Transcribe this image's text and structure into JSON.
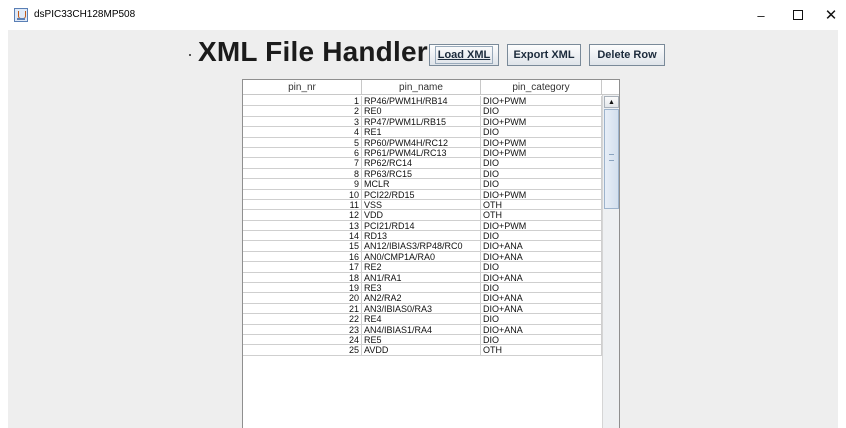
{
  "window": {
    "title": "dsPIC33CH128MP508",
    "icon": "java-cup-icon",
    "controls": {
      "minimize": "–",
      "maximize": "",
      "close": "✕"
    }
  },
  "header": {
    "title": "XML File Handler"
  },
  "toolbar": {
    "load_label": "Load XML",
    "export_label": "Export XML",
    "delete_label": "Delete Row"
  },
  "table": {
    "columns": [
      "pin_nr",
      "pin_name",
      "pin_category"
    ],
    "rows": [
      [
        "1",
        "RP46/PWM1H/RB14",
        "DIO+PWM"
      ],
      [
        "2",
        "RE0",
        "DIO"
      ],
      [
        "3",
        "RP47/PWM1L/RB15",
        "DIO+PWM"
      ],
      [
        "4",
        "RE1",
        "DIO"
      ],
      [
        "5",
        "RP60/PWM4H/RC12",
        "DIO+PWM"
      ],
      [
        "6",
        "RP61/PWM4L/RC13",
        "DIO+PWM"
      ],
      [
        "7",
        "RP62/RC14",
        "DIO"
      ],
      [
        "8",
        "RP63/RC15",
        "DIO"
      ],
      [
        "9",
        "MCLR",
        "DIO"
      ],
      [
        "10",
        "PCI22/RD15",
        "DIO+PWM"
      ],
      [
        "11",
        "VSS",
        "OTH"
      ],
      [
        "12",
        "VDD",
        "OTH"
      ],
      [
        "13",
        "PCI21/RD14",
        "DIO+PWM"
      ],
      [
        "14",
        "RD13",
        "DIO"
      ],
      [
        "15",
        "AN12/IBIAS3/RP48/RC0",
        "DIO+ANA"
      ],
      [
        "16",
        "AN0/CMP1A/RA0",
        "DIO+ANA"
      ],
      [
        "17",
        "RE2",
        "DIO"
      ],
      [
        "18",
        "AN1/RA1",
        "DIO+ANA"
      ],
      [
        "19",
        "RE3",
        "DIO"
      ],
      [
        "20",
        "AN2/RA2",
        "DIO+ANA"
      ],
      [
        "21",
        "AN3/IBIAS0/RA3",
        "DIO+ANA"
      ],
      [
        "22",
        "RE4",
        "DIO"
      ],
      [
        "23",
        "AN4/IBIAS1/RA4",
        "DIO+ANA"
      ],
      [
        "24",
        "RE5",
        "DIO"
      ],
      [
        "25",
        "AVDD",
        "OTH"
      ]
    ]
  }
}
